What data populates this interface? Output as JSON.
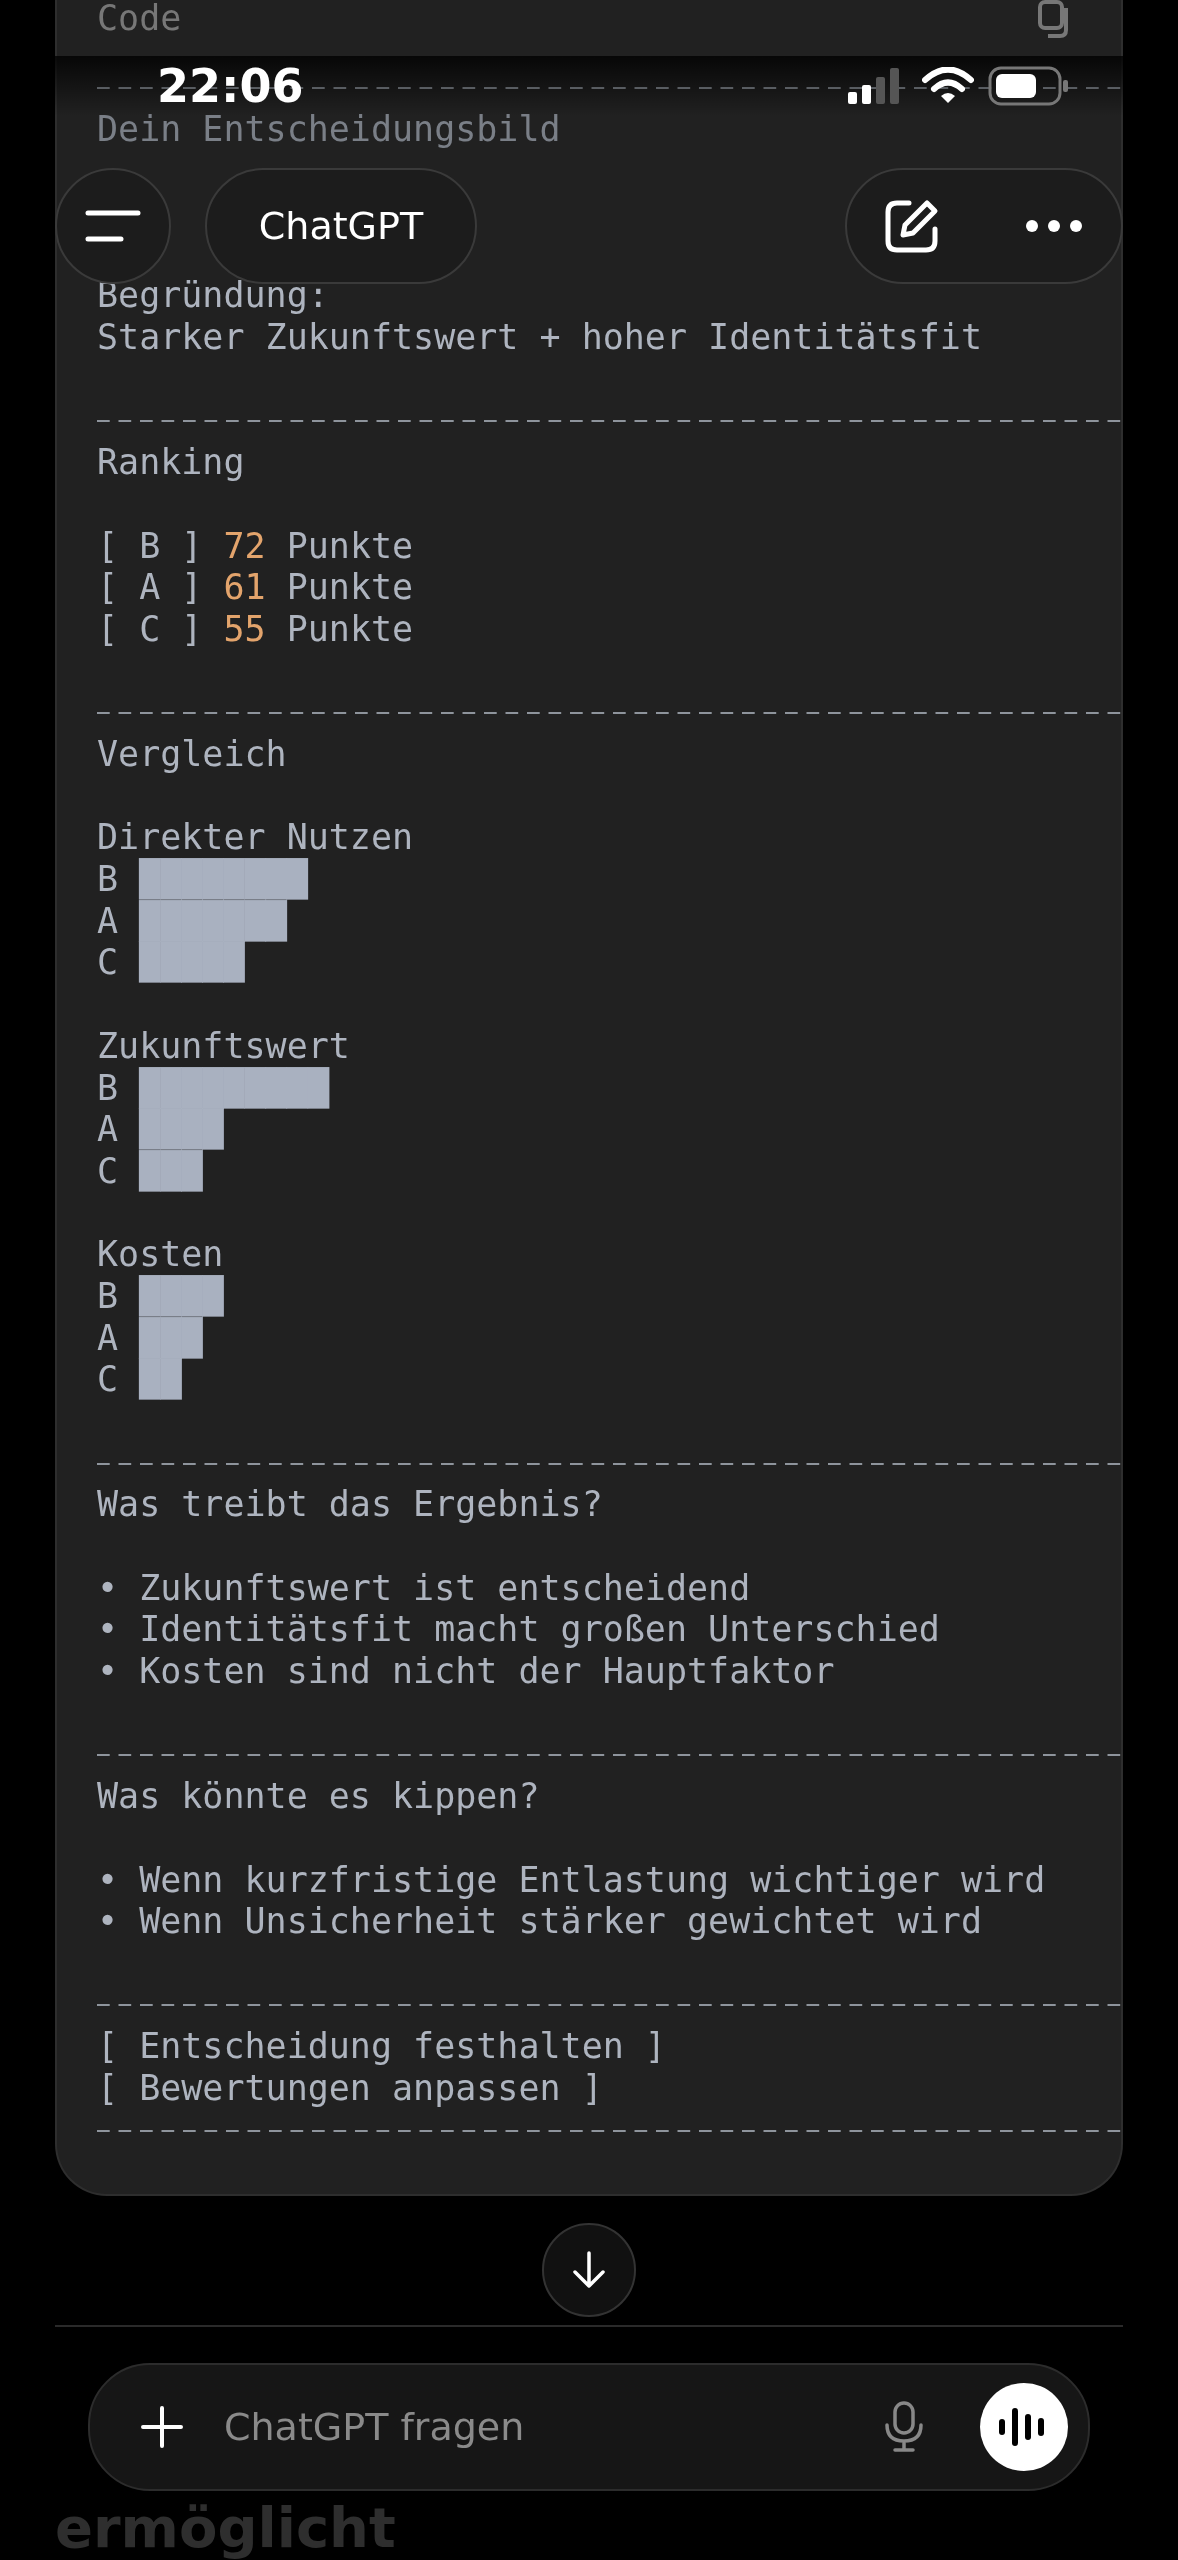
{
  "status_bar": {
    "time": "22:06"
  },
  "header": {
    "title": "ChatGPT"
  },
  "code_block": {
    "language": "Code",
    "sections": [
      {
        "kind": "summary",
        "title": "Dein Entscheidungsbild",
        "lines": [
          "Begründung:",
          "Starker Zukunftswert + hoher Identitätsfit"
        ]
      },
      {
        "kind": "ranking",
        "title": "Ranking",
        "rows": [
          {
            "label": "[ B ]",
            "points": "72",
            "unit": "Punkte"
          },
          {
            "label": "[ A ]",
            "points": "61",
            "unit": "Punkte"
          },
          {
            "label": "[ C ]",
            "points": "55",
            "unit": "Punkte"
          }
        ]
      },
      {
        "kind": "bars",
        "title": "Vergleich",
        "groups": [
          {
            "title": "Direkter Nutzen",
            "bars": [
              {
                "label": "B",
                "blocks": "████████"
              },
              {
                "label": "A",
                "blocks": "███████"
              },
              {
                "label": "C",
                "blocks": "█████"
              }
            ]
          },
          {
            "title": "Zukunftswert",
            "bars": [
              {
                "label": "B",
                "blocks": "█████████"
              },
              {
                "label": "A",
                "blocks": "████"
              },
              {
                "label": "C",
                "blocks": "███"
              }
            ]
          },
          {
            "title": "Kosten",
            "bars": [
              {
                "label": "B",
                "blocks": "████"
              },
              {
                "label": "A",
                "blocks": "███"
              },
              {
                "label": "C",
                "blocks": "██"
              }
            ]
          }
        ]
      },
      {
        "kind": "bullets",
        "title": "Was treibt das Ergebnis?",
        "lines": [
          "• Zukunftswert ist entscheidend",
          "• Identitätsfit macht großen Unterschied",
          "• Kosten sind nicht der Hauptfaktor"
        ]
      },
      {
        "kind": "bullets",
        "title": "Was könnte es kippen?",
        "lines": [
          "• Wenn kurzfristige Entlastung wichtiger wird",
          "• Wenn Unsicherheit stärker gewichtet wird"
        ]
      },
      {
        "kind": "actions",
        "lines": [
          "[ Entscheidung festhalten ]",
          "[ Bewertungen anpassen ]"
        ]
      }
    ]
  },
  "composer": {
    "placeholder": "ChatGPT fragen"
  },
  "next_message": {
    "text": "ermöglicht"
  }
}
